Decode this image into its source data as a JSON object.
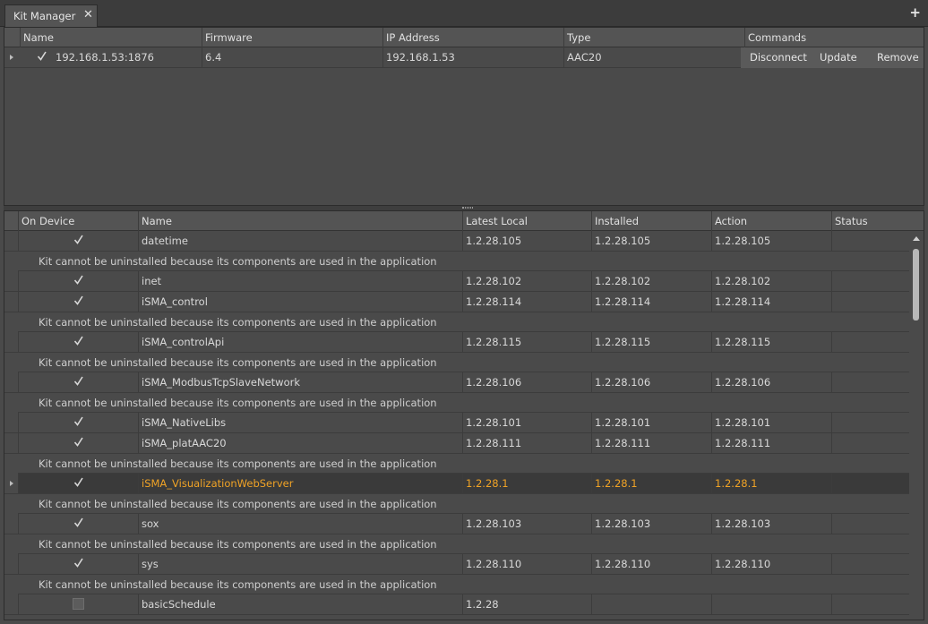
{
  "tab": {
    "title": "Kit Manager",
    "close_glyph": "✕",
    "add_glyph": "+"
  },
  "devices": {
    "columns": [
      "Name",
      "Firmware",
      "IP Address",
      "Type",
      "Commands"
    ],
    "rows": [
      {
        "checked": true,
        "name": "192.168.1.53:1876",
        "firmware": "6.4",
        "ip": "192.168.1.53",
        "type": "AAC20",
        "commands": [
          "Disconnect",
          "Update",
          "Remove"
        ]
      }
    ]
  },
  "kits": {
    "columns": [
      "On Device",
      "Name",
      "Latest Local",
      "Installed",
      "Action",
      "Status"
    ],
    "note": "Kit cannot be uninstalled because its components are used in the application",
    "rows": [
      {
        "checked": true,
        "name": "datetime",
        "latest": "1.2.28.105",
        "installed": "1.2.28.105",
        "action": "1.2.28.105",
        "note": true,
        "selected": false
      },
      {
        "checked": true,
        "name": "inet",
        "latest": "1.2.28.102",
        "installed": "1.2.28.102",
        "action": "1.2.28.102",
        "note": false,
        "selected": false
      },
      {
        "checked": true,
        "name": "iSMA_control",
        "latest": "1.2.28.114",
        "installed": "1.2.28.114",
        "action": "1.2.28.114",
        "note": true,
        "selected": false
      },
      {
        "checked": true,
        "name": "iSMA_controlApi",
        "latest": "1.2.28.115",
        "installed": "1.2.28.115",
        "action": "1.2.28.115",
        "note": true,
        "selected": false
      },
      {
        "checked": true,
        "name": "iSMA_ModbusTcpSlaveNetwork",
        "latest": "1.2.28.106",
        "installed": "1.2.28.106",
        "action": "1.2.28.106",
        "note": true,
        "selected": false
      },
      {
        "checked": true,
        "name": "iSMA_NativeLibs",
        "latest": "1.2.28.101",
        "installed": "1.2.28.101",
        "action": "1.2.28.101",
        "note": false,
        "selected": false
      },
      {
        "checked": true,
        "name": "iSMA_platAAC20",
        "latest": "1.2.28.111",
        "installed": "1.2.28.111",
        "action": "1.2.28.111",
        "note": true,
        "selected": false
      },
      {
        "checked": true,
        "name": "iSMA_VisualizationWebServer",
        "latest": "1.2.28.1",
        "installed": "1.2.28.1",
        "action": "1.2.28.1",
        "note": true,
        "selected": true
      },
      {
        "checked": true,
        "name": "sox",
        "latest": "1.2.28.103",
        "installed": "1.2.28.103",
        "action": "1.2.28.103",
        "note": true,
        "selected": false
      },
      {
        "checked": true,
        "name": "sys",
        "latest": "1.2.28.110",
        "installed": "1.2.28.110",
        "action": "1.2.28.110",
        "note": true,
        "selected": false
      },
      {
        "checked": false,
        "name": "basicSchedule",
        "latest": "1.2.28",
        "installed": "",
        "action": "",
        "note": false,
        "selected": false
      }
    ]
  },
  "colors": {
    "accent": "#f0a326",
    "background": "#4a4a4a",
    "header": "#545454"
  }
}
